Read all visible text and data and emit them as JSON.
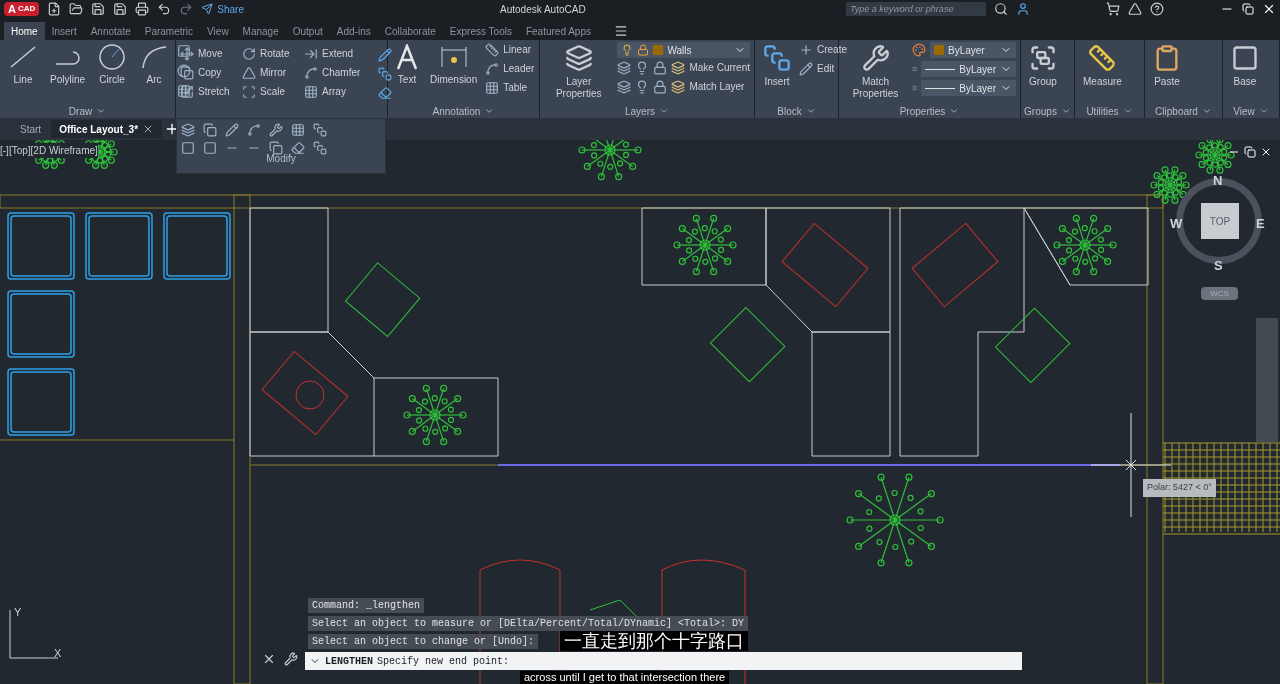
{
  "app": {
    "logo_letter": "A",
    "logo_badge": "CAD",
    "share": "Share",
    "title": "Autodesk AutoCAD",
    "search": {
      "placeholder": "Type a keyword or phrase"
    }
  },
  "ribbon_tabs": [
    {
      "label": "Home",
      "selected": true
    },
    {
      "label": "Insert",
      "selected": false
    },
    {
      "label": "Annotate",
      "selected": false
    },
    {
      "label": "Parametric",
      "selected": false
    },
    {
      "label": "View",
      "selected": false
    },
    {
      "label": "Manage",
      "selected": false
    },
    {
      "label": "Output",
      "selected": false
    },
    {
      "label": "Add-ins",
      "selected": false
    },
    {
      "label": "Collaborate",
      "selected": false
    },
    {
      "label": "Express Tools",
      "selected": false
    },
    {
      "label": "Featured Apps",
      "selected": false
    }
  ],
  "panels": {
    "draw": {
      "title": "Draw",
      "tools": [
        "Line",
        "Polyline",
        "Circle",
        "Arc"
      ]
    },
    "modify": {
      "title": "Modify",
      "rows": [
        [
          "Move",
          "Rotate",
          "Extend"
        ],
        [
          "Copy",
          "Mirror",
          "Chamfer"
        ],
        [
          "Stretch",
          "Scale",
          "Array"
        ]
      ]
    },
    "annotation": {
      "title": "Annotation",
      "large": [
        "Text",
        "Dimension"
      ],
      "small": [
        "Linear",
        "Leader",
        "Table"
      ]
    },
    "layers": {
      "title": "Layers",
      "large": "Layer Properties",
      "current_layer": "Walls",
      "small": [
        "Make Current",
        "Match Layer"
      ]
    },
    "block": {
      "title": "Block",
      "large": "Insert",
      "small": [
        "Create",
        "Edit"
      ]
    },
    "properties": {
      "title": "Properties",
      "large": "Match Properties",
      "values": [
        "ByLayer",
        "ByLayer",
        "ByLayer"
      ]
    },
    "groups": {
      "title": "Groups",
      "large": "Group"
    },
    "utilities": {
      "title": "Utilities",
      "large": "Measure"
    },
    "clipboard": {
      "title": "Clipboard",
      "large": "Paste"
    },
    "view": {
      "title": "View",
      "large": "Base"
    }
  },
  "doc_tabs": [
    {
      "label": "Start",
      "selected": false
    },
    {
      "label": "Office Layout_3*",
      "selected": true
    }
  ],
  "viewport": {
    "label": "[-][Top][2D Wireframe]",
    "compass": {
      "n": "N",
      "s": "S",
      "e": "E",
      "w": "W",
      "cube": "TOP",
      "ucs": "WCS"
    },
    "tooltip": "Polar: 5427 < 0°",
    "axis_x": "X",
    "axis_y": "Y"
  },
  "command": {
    "history": [
      "Command: _lengthen",
      "Select an object to measure or [DElta/Percent/Total/DYnamic] <Total>: DY",
      "Select an object to change or [Undo]:"
    ],
    "name": "LENGTHEN",
    "prompt": "Specify new end point:"
  },
  "subtitles": [
    "一直走到那个十字路口",
    "across until I get to that intersection there"
  ]
}
